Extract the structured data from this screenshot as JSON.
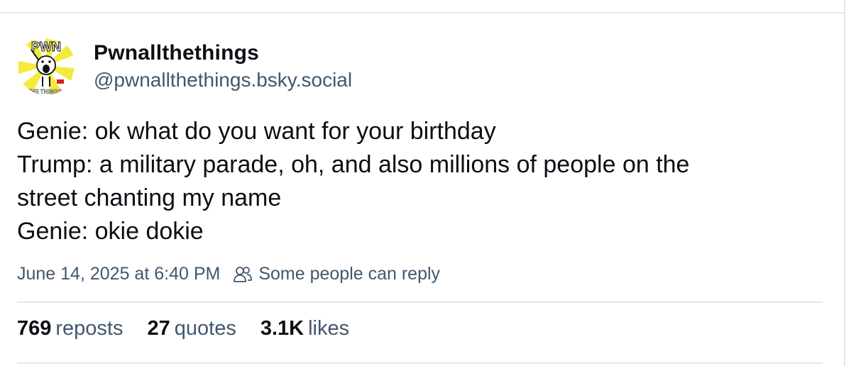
{
  "author": {
    "display_name": "Pwnallthethings",
    "handle": "@pwnallthethings.bsky.social",
    "avatar_icon": "pwn-all-the-things-avatar",
    "avatar_text_top": "PWN",
    "avatar_text_bottom": "ALL THE THINGS"
  },
  "post": {
    "lines": [
      "Genie: ok what do you want for your birthday",
      "Trump: a military parade, oh, and also millions of people on the",
      "street chanting my name",
      "Genie: okie dokie"
    ]
  },
  "meta": {
    "date": "June 14, 2025 at 6:40 PM",
    "reply_setting": "Some people can reply",
    "reply_icon": "people-icon"
  },
  "stats": {
    "reposts_count": "769",
    "reposts_label": "reposts",
    "quotes_count": "27",
    "quotes_label": "quotes",
    "likes_count": "3.1K",
    "likes_label": "likes"
  },
  "colors": {
    "text": "#0b0f14",
    "muted": "#42576c",
    "border": "#e2e7ee",
    "avatar_yellow": "#f4ea3c"
  }
}
